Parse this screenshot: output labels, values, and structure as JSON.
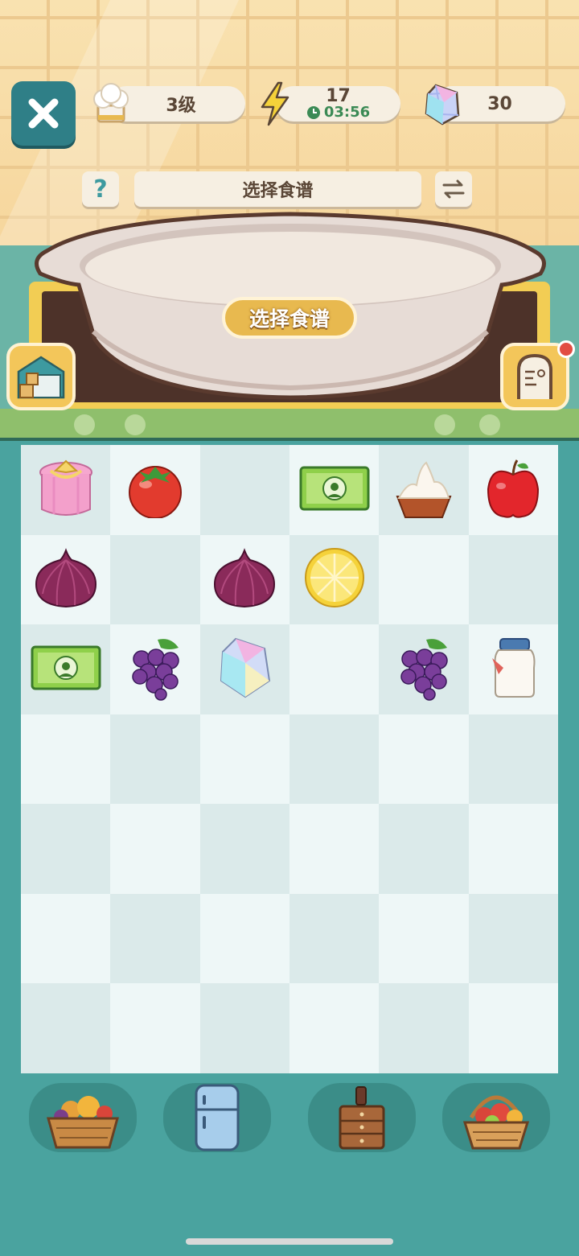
{
  "topbar": {
    "close_icon": "close-x-icon",
    "level": {
      "icon": "chef-hat-icon",
      "label": "3级"
    },
    "energy": {
      "icon": "lightning-icon",
      "value": "17",
      "timer": "03:56"
    },
    "gems": {
      "icon": "crystal-gem-icon",
      "value": "30"
    }
  },
  "recipe": {
    "help_label": "?",
    "title": "选择食谱",
    "switch_icon": "swap-arrows-icon",
    "choose_button": "选择食谱"
  },
  "side_buttons": {
    "left_icon": "warehouse-icon",
    "right_icon": "menu-board-icon"
  },
  "grid": {
    "rows": [
      [
        "gift-box",
        "tomato",
        "",
        "cash",
        "cream",
        "apple"
      ],
      [
        "onion",
        "",
        "onion",
        "lemon",
        "",
        ""
      ],
      [
        "cash",
        "grapes",
        "crystal",
        "",
        "grapes",
        "milk-jar"
      ],
      [
        "",
        "",
        "",
        "",
        "",
        ""
      ],
      [
        "",
        "",
        "",
        "",
        "",
        ""
      ],
      [
        "",
        "",
        "",
        "",
        "",
        ""
      ],
      [
        "",
        "",
        "",
        "",
        "",
        ""
      ]
    ]
  },
  "dock": [
    {
      "icon": "vegetable-basket-icon"
    },
    {
      "icon": "refrigerator-icon"
    },
    {
      "icon": "cabinet-icon"
    },
    {
      "icon": "fruit-basket-icon"
    }
  ],
  "colors": {
    "accent": "#2f7f87",
    "board_bg": "#4aa39f",
    "gold": "#e8b94f"
  }
}
